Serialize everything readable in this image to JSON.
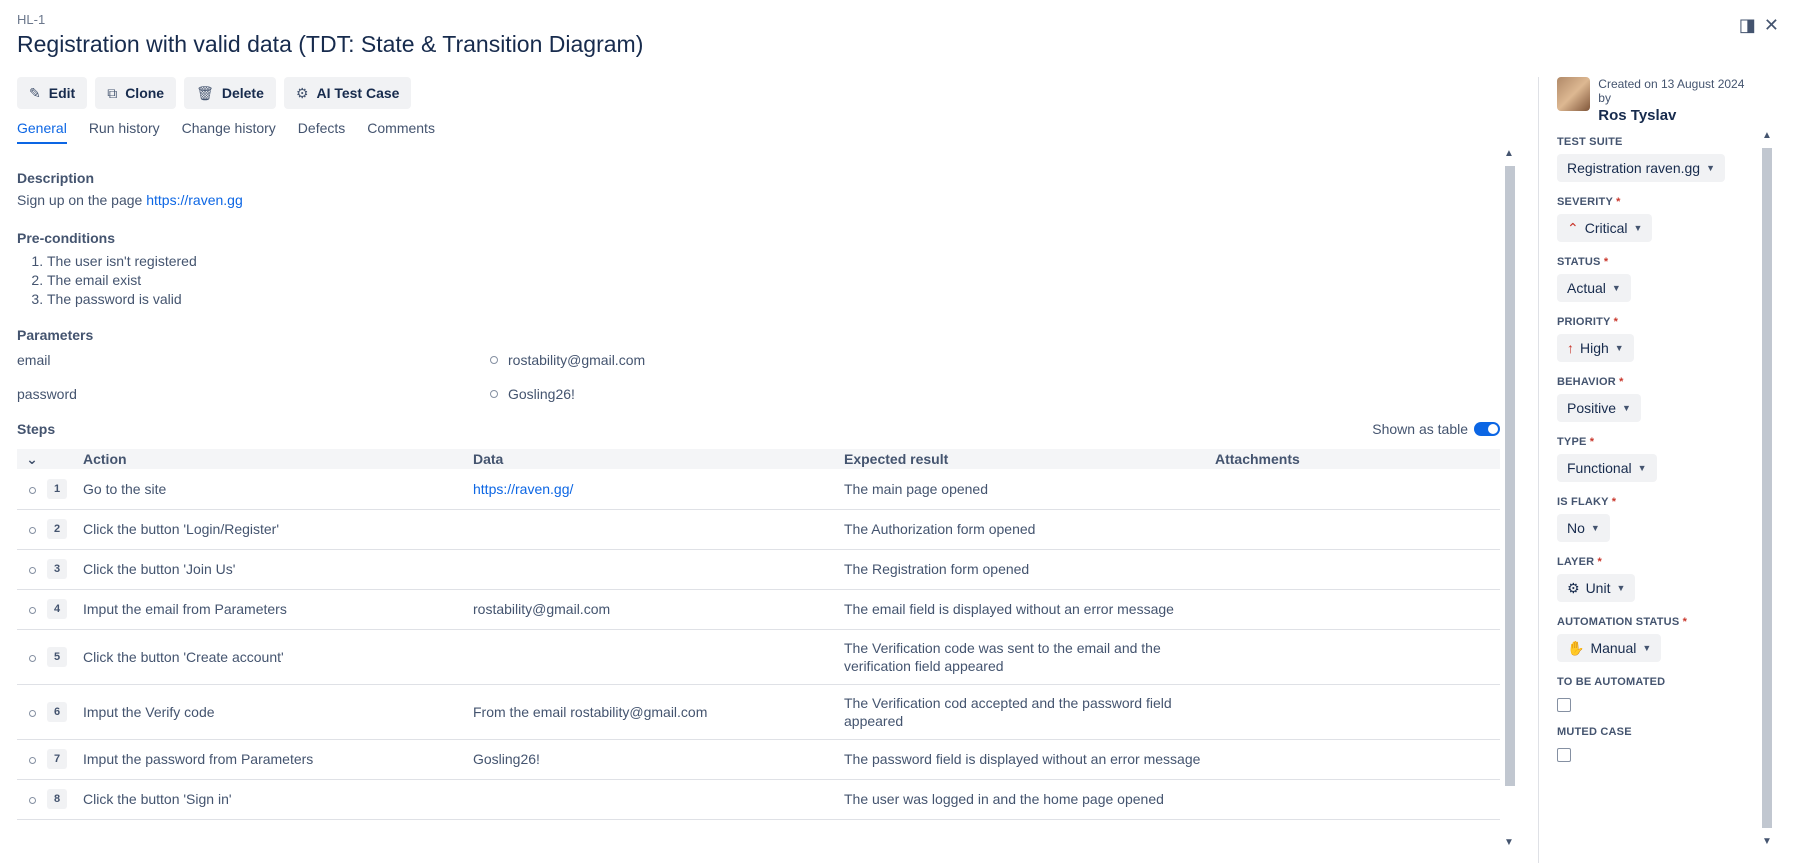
{
  "case": {
    "id": "HL-1",
    "title": "Registration with valid data (TDT: State & Transition Diagram)"
  },
  "toolbar": {
    "edit": "Edit",
    "clone": "Clone",
    "delete": "Delete",
    "ai": "AI Test Case"
  },
  "tabs": [
    "General",
    "Run history",
    "Change history",
    "Defects",
    "Comments"
  ],
  "description": {
    "label": "Description",
    "text": "Sign up on the page ",
    "link": "https://raven.gg"
  },
  "preconditions": {
    "label": "Pre-conditions",
    "items": [
      "The user isn't registered",
      "The email exist",
      "The password is valid"
    ]
  },
  "parameters": {
    "label": "Parameters",
    "items": [
      {
        "name": "email",
        "value": "rostability@gmail.com"
      },
      {
        "name": "password",
        "value": "Gosling26!"
      }
    ]
  },
  "steps": {
    "label": "Steps",
    "toggle_label": "Shown as table",
    "headers": {
      "action": "Action",
      "data": "Data",
      "expected": "Expected result",
      "attachments": "Attachments"
    },
    "rows": [
      {
        "n": "1",
        "action": "Go to the site",
        "data": "https://raven.gg/",
        "expected": "The main page opened"
      },
      {
        "n": "2",
        "action": "Click the button 'Login/Register'",
        "data": "",
        "expected": "The Authorization form opened"
      },
      {
        "n": "3",
        "action": "Click the button 'Join Us'",
        "data": "",
        "expected": "The Registration form opened"
      },
      {
        "n": "4",
        "action": "Imput the email from Parameters",
        "data": "rostability@gmail.com",
        "expected": "The email field is displayed without an error message"
      },
      {
        "n": "5",
        "action": "Click the button 'Create account'",
        "data": "",
        "expected": "The Verification code was sent to the email and the verification field appeared"
      },
      {
        "n": "6",
        "action": "Imput the Verify code",
        "data": "From the email rostability@gmail.com",
        "expected": "The Verification cod accepted and the password field appeared"
      },
      {
        "n": "7",
        "action": "Imput the password from Parameters",
        "data": "Gosling26!",
        "expected": "The password field is displayed without an error message"
      },
      {
        "n": "8",
        "action": "Click the button 'Sign in'",
        "data": "",
        "expected": "The user was logged in and the home page opened"
      }
    ]
  },
  "sidebar": {
    "created_on": "Created on 13 August 2024 by",
    "creator": "Ros Tyslav",
    "test_suite": {
      "label": "TEST SUITE",
      "value": "Registration raven.gg"
    },
    "severity": {
      "label": "SEVERITY",
      "value": "Critical"
    },
    "status": {
      "label": "STATUS",
      "value": "Actual"
    },
    "priority": {
      "label": "PRIORITY",
      "value": "High"
    },
    "behavior": {
      "label": "BEHAVIOR",
      "value": "Positive"
    },
    "type": {
      "label": "TYPE",
      "value": "Functional"
    },
    "is_flaky": {
      "label": "IS FLAKY",
      "value": "No"
    },
    "layer": {
      "label": "LAYER",
      "value": "Unit"
    },
    "automation_status": {
      "label": "AUTOMATION STATUS",
      "value": "Manual"
    },
    "to_be_automated": {
      "label": "TO BE AUTOMATED",
      "checked": false
    },
    "muted_case": {
      "label": "MUTED CASE",
      "checked": false
    }
  },
  "colors": {
    "accent": "#0c66e4",
    "required": "#c9372c",
    "severity": "#c9372c",
    "priority": "#c9372c"
  }
}
